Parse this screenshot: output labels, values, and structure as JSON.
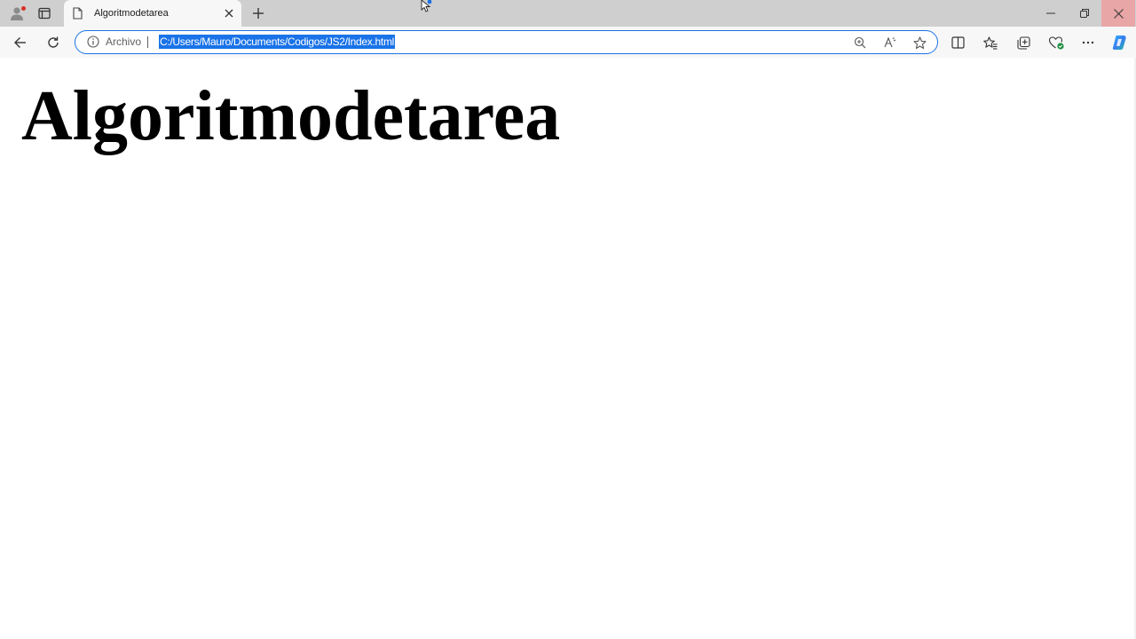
{
  "browser": {
    "tab": {
      "title": "Algoritmodetarea"
    },
    "address_bar": {
      "site_label": "Archivo",
      "url": "C:/Users/Mauro/Documents/Codigos/JS2/Index.html"
    },
    "icons": {
      "profile": "profile-icon",
      "tab_actions": "tab-actions-icon",
      "page": "page-icon",
      "close": "close-icon",
      "new_tab": "plus-icon",
      "back": "back-arrow-icon",
      "reload": "reload-icon",
      "info": "info-icon",
      "zoom": "zoom-icon",
      "read_aloud": "read-aloud-icon",
      "favorite": "star-icon",
      "split_screen": "split-screen-icon",
      "favorites": "favorites-icon",
      "collections": "collections-icon",
      "browser_essentials": "heart-pulse-icon",
      "more": "more-icon",
      "copilot": "copilot-icon"
    },
    "colors": {
      "accent": "#1a73e8",
      "titlebar": "#cfcfcf",
      "toolbar": "#f7f7f7",
      "close_hover": "#e8a6a6"
    }
  },
  "page": {
    "heading": "Algoritmodetarea"
  }
}
